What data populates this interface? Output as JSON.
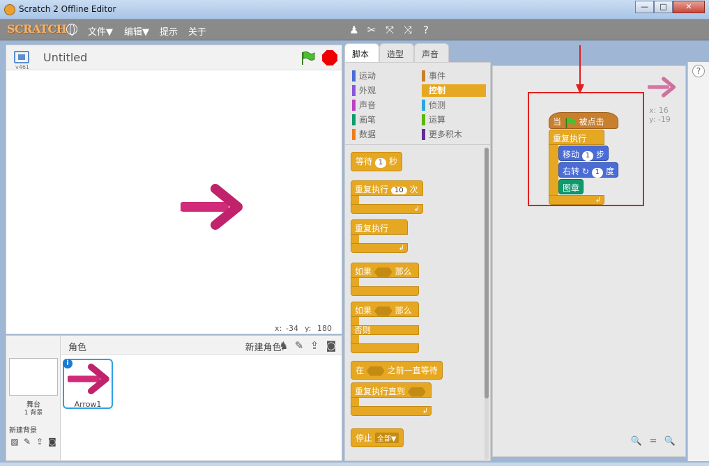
{
  "window": {
    "title": "Scratch 2 Offline Editor",
    "minimize": "—",
    "maximize": "□",
    "close": "✕"
  },
  "menubar": {
    "logo": "SCRATCH",
    "items": [
      "文件▼",
      "编辑▼",
      "提示",
      "关于"
    ]
  },
  "stage": {
    "version": "v461",
    "project_title": "Untitled",
    "mouse_x_label": "x:",
    "mouse_x": "-34",
    "mouse_y_label": "y:",
    "mouse_y": "180"
  },
  "sprites": {
    "header": "角色",
    "new_sprite_label": "新建角色:",
    "stage_label": "舞台",
    "stage_backdrops": "1 背景",
    "new_backdrop_label": "新建背景",
    "selected_sprite": "Arrow1",
    "info": "i"
  },
  "tabs": [
    "脚本",
    "造型",
    "声音"
  ],
  "categories": [
    {
      "label": "运动",
      "color": "#4a6cd4"
    },
    {
      "label": "事件",
      "color": "#c8802e"
    },
    {
      "label": "外观",
      "color": "#8a55d7"
    },
    {
      "label": "控制",
      "color": "#e6a822",
      "active": true
    },
    {
      "label": "声音",
      "color": "#bb42c3"
    },
    {
      "label": "侦测",
      "color": "#2ca5e2"
    },
    {
      "label": "画笔",
      "color": "#0e9a6c"
    },
    {
      "label": "运算",
      "color": "#5cb712"
    },
    {
      "label": "数据",
      "color": "#ee7d16"
    },
    {
      "label": "更多积木",
      "color": "#632d99"
    }
  ],
  "palette_blocks": {
    "wait_pre": "等待",
    "wait_val": "1",
    "wait_post": "秒",
    "repeat_pre": "重复执行",
    "repeat_val": "10",
    "repeat_post": "次",
    "forever": "重复执行",
    "if_pre": "如果",
    "if_post": "那么",
    "ifelse_pre": "如果",
    "ifelse_post": "那么",
    "else": "否则",
    "waituntil_pre": "在",
    "waituntil_post": "之前一直等待",
    "repeatuntil": "重复执行直到",
    "stop": "停止",
    "stop_option": "全部▼",
    "loop_glyph": "↲"
  },
  "script": {
    "hat_pre": "当",
    "hat_post": "被点击",
    "forever": "重复执行",
    "move_pre": "移动",
    "move_val": "1",
    "move_post": "步",
    "turn_pre": "右转",
    "turn_glyph": "↻",
    "turn_val": "1",
    "turn_post": "度",
    "stamp": "图章",
    "loop_glyph": "↲",
    "sprite_x": "x: 16",
    "sprite_y": "y: -19"
  },
  "zoom": {
    "out": "🔍",
    "reset": "=",
    "in": "🔍"
  },
  "help": "?"
}
